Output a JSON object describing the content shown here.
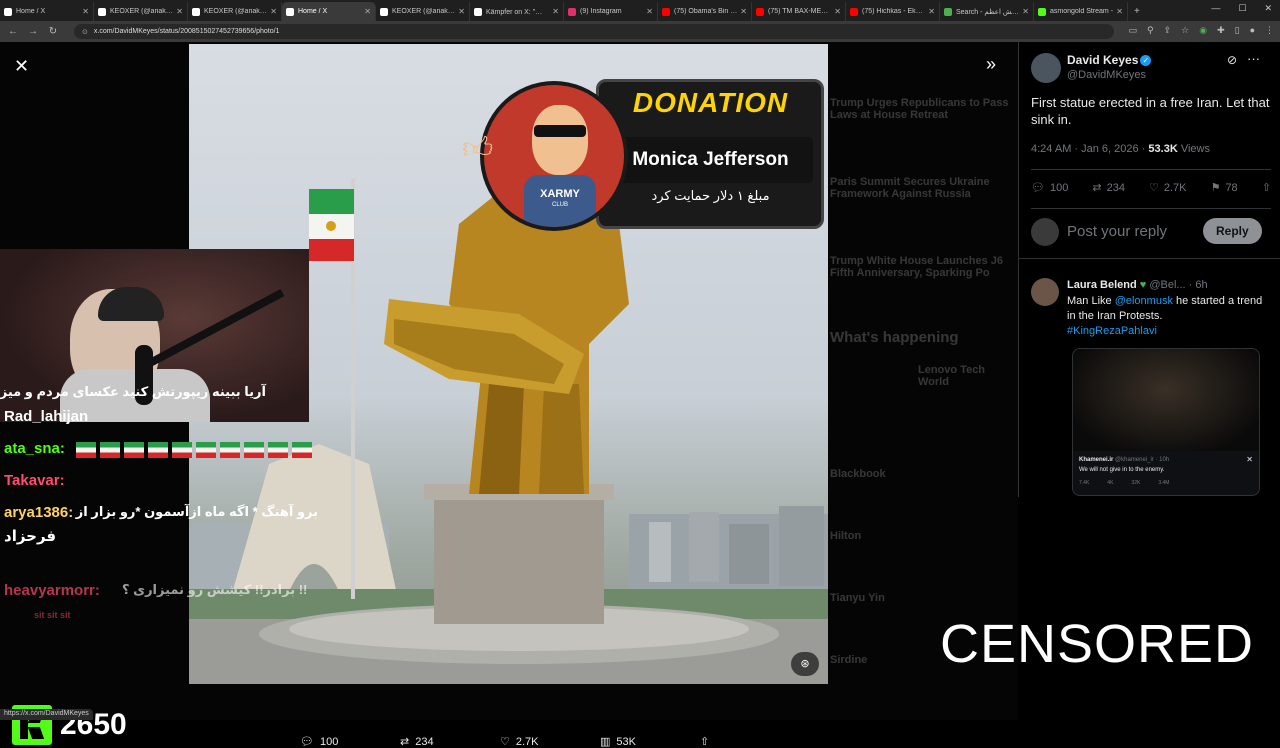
{
  "browser": {
    "tabs": [
      {
        "title": "Home / X",
        "color": "#ffffff",
        "active": false
      },
      {
        "title": "KEOXER (@ariakeoxer)",
        "color": "#ffffff",
        "active": false
      },
      {
        "title": "KEOXER (@ariakeoxer)",
        "color": "#ffffff",
        "active": false
      },
      {
        "title": "Home / X",
        "color": "#ffffff",
        "active": true
      },
      {
        "title": "KEOXER (@ariakeoxer)",
        "color": "#ffffff",
        "active": false
      },
      {
        "title": "Kämpfer on X: \"کیش",
        "color": "#ffffff",
        "active": false
      },
      {
        "title": "(9) Instagram",
        "color": "#e1306c",
        "active": false
      },
      {
        "title": "(75) Obama's Bin Lade",
        "color": "#ff0000",
        "active": false
      },
      {
        "title": "(75) TM BAX-MEYDOO",
        "color": "#ff0000",
        "active": false
      },
      {
        "title": "(75) Hichkas - Ekhtela",
        "color": "#ff0000",
        "active": false
      },
      {
        "title": "Search - کشکش اعظم",
        "color": "#4caf50",
        "active": false
      },
      {
        "title": "asmongold Stream -",
        "color": "#53fc18",
        "active": false
      }
    ],
    "new_tab_label": "+",
    "url": "x.com/DavidMKeyes/status/2008515027452739656/photo/1",
    "status_url": "https://x.com/DavidMKeyes"
  },
  "tweet": {
    "author_name": "David Keyes",
    "author_handle": "@DavidMKeyes",
    "text": "First statue erected in a free Iran. Let that sink in.",
    "timestamp": "4:24 AM · Jan 6, 2026 · ",
    "views_count": "53.3K",
    "views_label": " Views",
    "replies": "100",
    "reposts": "234",
    "likes": "2.7K",
    "bookmarks": "78",
    "reply_placeholder": "Post your reply",
    "reply_button": "Reply"
  },
  "reply_tweet": {
    "author_name": "Laura Belend",
    "author_meta": "@Bel... · 6h",
    "text_prefix": "Man Like ",
    "mention": "@elonmusk",
    "text_suffix": " he started a trend in the Iran Protests.",
    "hashtag": "#KingRezaPahlavi",
    "embedded_author": "Khamenei.ir",
    "embedded_handle": "@khamenei_ir · 10h",
    "embedded_text": "We will not give in to the enemy.",
    "embedded_stats": [
      "7.4K",
      "4K",
      "32K",
      "3.4M"
    ]
  },
  "photo_stats": {
    "replies": "100",
    "reposts": "234",
    "likes": "2.7K",
    "views": "53K"
  },
  "background_feed": [
    "Trump Urges Republicans to Pass Laws at House Retreat",
    "Paris Summit Secures Ukraine Framework Against Russia",
    "Trump White House Launches J6 Fifth Anniversary, Sparking Po",
    "What's happening",
    "Lenovo Tech World",
    "Blackbook",
    "Hilton",
    "Tianyu Yin",
    "Sirdine"
  ],
  "donation": {
    "label": "DONATION",
    "donor": "Monica Jefferson",
    "message": "مبلغ ۱ دلار حمایت کرد",
    "mascot_text": "XARMY",
    "mascot_sub": "CLUB"
  },
  "chat": [
    {
      "user": "",
      "text": "آریا ببینه ریپورتش کنید عکسای مردم و میزاره",
      "user_color": "#ffffff"
    },
    {
      "user": "Rad_lahijan",
      "text": "",
      "user_color": "#ffffff"
    },
    {
      "user": "ata_sna:",
      "text": "",
      "user_color": "#53fc18"
    },
    {
      "user": "Takavar:",
      "text": "",
      "user_color": "#ff4d6d"
    },
    {
      "user": "arya1386:",
      "text": "برو آهنگ * اگه ماه ازآسمون *رو بزار از",
      "user_color": "#ffd166"
    },
    {
      "user": "",
      "text": "فرحزاد",
      "user_color": "#ffffff"
    },
    {
      "user": "heavyarmorr:",
      "text": "!! برادر!! کیشش رو نمیزاری ؟",
      "user_color": "#ff4d6d"
    },
    {
      "user": "",
      "text": "sit  sit  sit",
      "user_color": "#ff4d6d"
    }
  ],
  "overlay": {
    "censored": "CENSORED",
    "kick_count": "2650"
  }
}
